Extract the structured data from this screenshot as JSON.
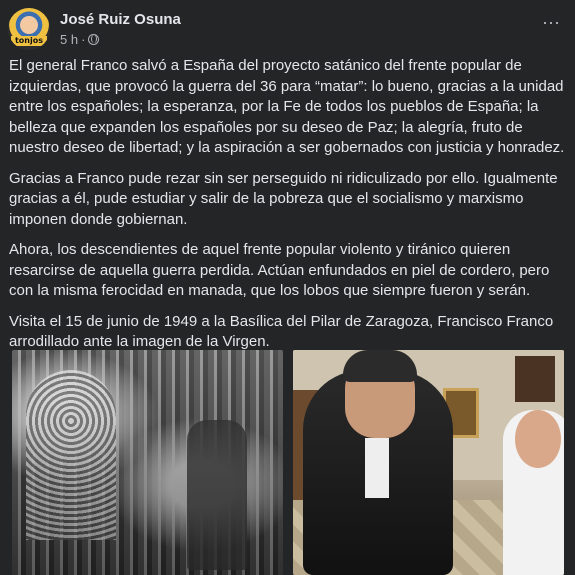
{
  "post": {
    "author": "José Ruiz Osuna",
    "time": "5 h",
    "separator": "·",
    "audience_icon": "globe-icon",
    "more_icon": "more-options-icon",
    "avatar_text": "tonjos",
    "paragraphs": [
      "El general Franco salvó a España del proyecto satánico del frente popular de izquierdas, que provocó la guerra del 36 para “matar”: lo bueno,  gracias a la unidad entre los españoles; la esperanza, por la Fe de todos los pueblos de España; la belleza que expanden los españoles por su deseo de Paz; la alegría, fruto de nuestro deseo de libertad; y la aspiración a ser gobernados con justicia y honradez.",
      "Gracias a Franco pude rezar sin ser perseguido ni ridiculizado por ello. Igualmente gracias a él, pude estudiar y salir de la pobreza que el socialismo y marxismo imponen donde gobiernan.",
      "Ahora, los descendientes de aquel frente popular violento y tiránico quieren resarcirse de aquella guerra perdida. Actúan enfundados en piel de cordero, pero con la misma ferocidad en manada, que los lobos que siempre fueron y serán.",
      "Visita el 15 de junio de 1949 a la Basílica del Pilar de Zaragoza, Francisco Franco arrodillado ante la imagen de la Virgen."
    ]
  },
  "colors": {
    "background": "#242526",
    "text_primary": "#e4e6eb",
    "text_secondary": "#b0b3b8"
  }
}
